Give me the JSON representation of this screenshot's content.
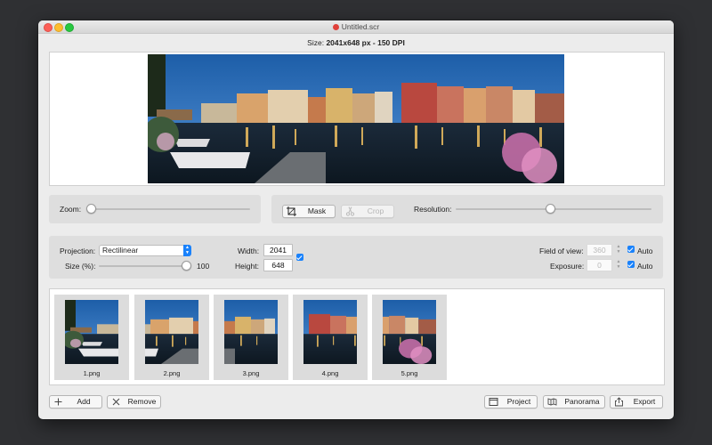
{
  "window": {
    "title": "Untitled.scr"
  },
  "info": {
    "size_label": "Size:",
    "size_value": "2041x648 px - 150 DPI"
  },
  "toolbar": {
    "zoom_label": "Zoom:",
    "mask_label": "Mask",
    "crop_label": "Crop",
    "resolution_label": "Resolution:",
    "zoom_level": 0,
    "resolution_level": 0.48
  },
  "settings": {
    "projection_label": "Projection:",
    "projection_value": "Rectilinear",
    "size_label": "Size (%):",
    "size_value": "100",
    "size_level": 1.0,
    "width_label": "Width:",
    "width_value": "2041",
    "height_label": "Height:",
    "height_value": "648",
    "fov_label": "Field of view:",
    "fov_value": "360",
    "exposure_label": "Exposure:",
    "exposure_value": "0",
    "auto_label": "Auto",
    "link_checked": true,
    "fov_auto_checked": true,
    "exposure_auto_checked": true
  },
  "images": [
    {
      "name": "1.png"
    },
    {
      "name": "2.png"
    },
    {
      "name": "3.png"
    },
    {
      "name": "4.png"
    },
    {
      "name": "5.png"
    }
  ],
  "footer": {
    "add_label": "Add",
    "remove_label": "Remove",
    "project_label": "Project",
    "panorama_label": "Panorama",
    "export_label": "Export"
  },
  "colors": {
    "accent": "#1a82fb",
    "close": "#fc5f57",
    "minimize": "#fdbd2e",
    "maximize": "#28c840"
  }
}
